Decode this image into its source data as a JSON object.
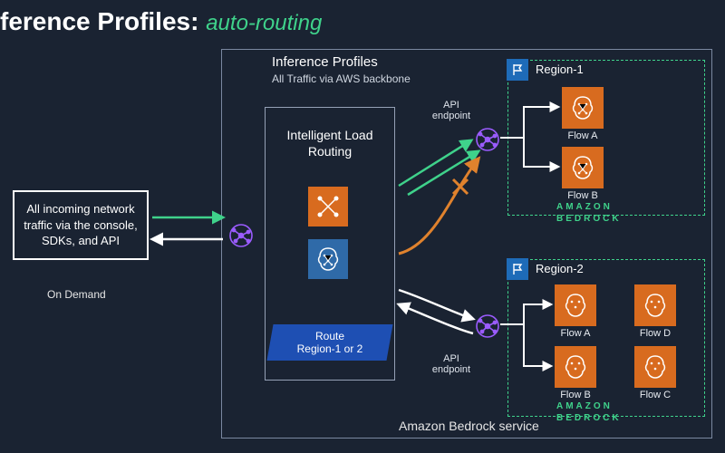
{
  "title": {
    "main": "ference Profiles:",
    "sub": "auto-routing"
  },
  "traffic": {
    "text": "All incoming network traffic via the console, SDKs, and API",
    "ondemand": "On Demand"
  },
  "service": {
    "title": "Inference Profiles",
    "subtitle": "All Traffic via AWS backbone",
    "ilr": "Intelligent Load Routing",
    "route_banner_l1": "Route",
    "route_banner_l2": "Region-1 or 2",
    "bottom_label": "Amazon Bedrock service"
  },
  "api_labels": {
    "ep1": "API endpoint",
    "ep2": "API endpoint"
  },
  "regions": {
    "r1": {
      "name": "Region-1",
      "flows": [
        "Flow A",
        "Flow B"
      ]
    },
    "r2": {
      "name": "Region-2",
      "flows": [
        "Flow A",
        "Flow B",
        "Flow D",
        "Flow C"
      ]
    }
  },
  "bedrock_text": "AMAZON BEDROCK",
  "colors": {
    "bg": "#1a2332",
    "green": "#3fd28b",
    "orange": "#d86b1f",
    "blue": "#2f6aa8",
    "banner": "#1e4fb3",
    "purple": "#9b5cff",
    "arrow_orange": "#e0822d"
  }
}
